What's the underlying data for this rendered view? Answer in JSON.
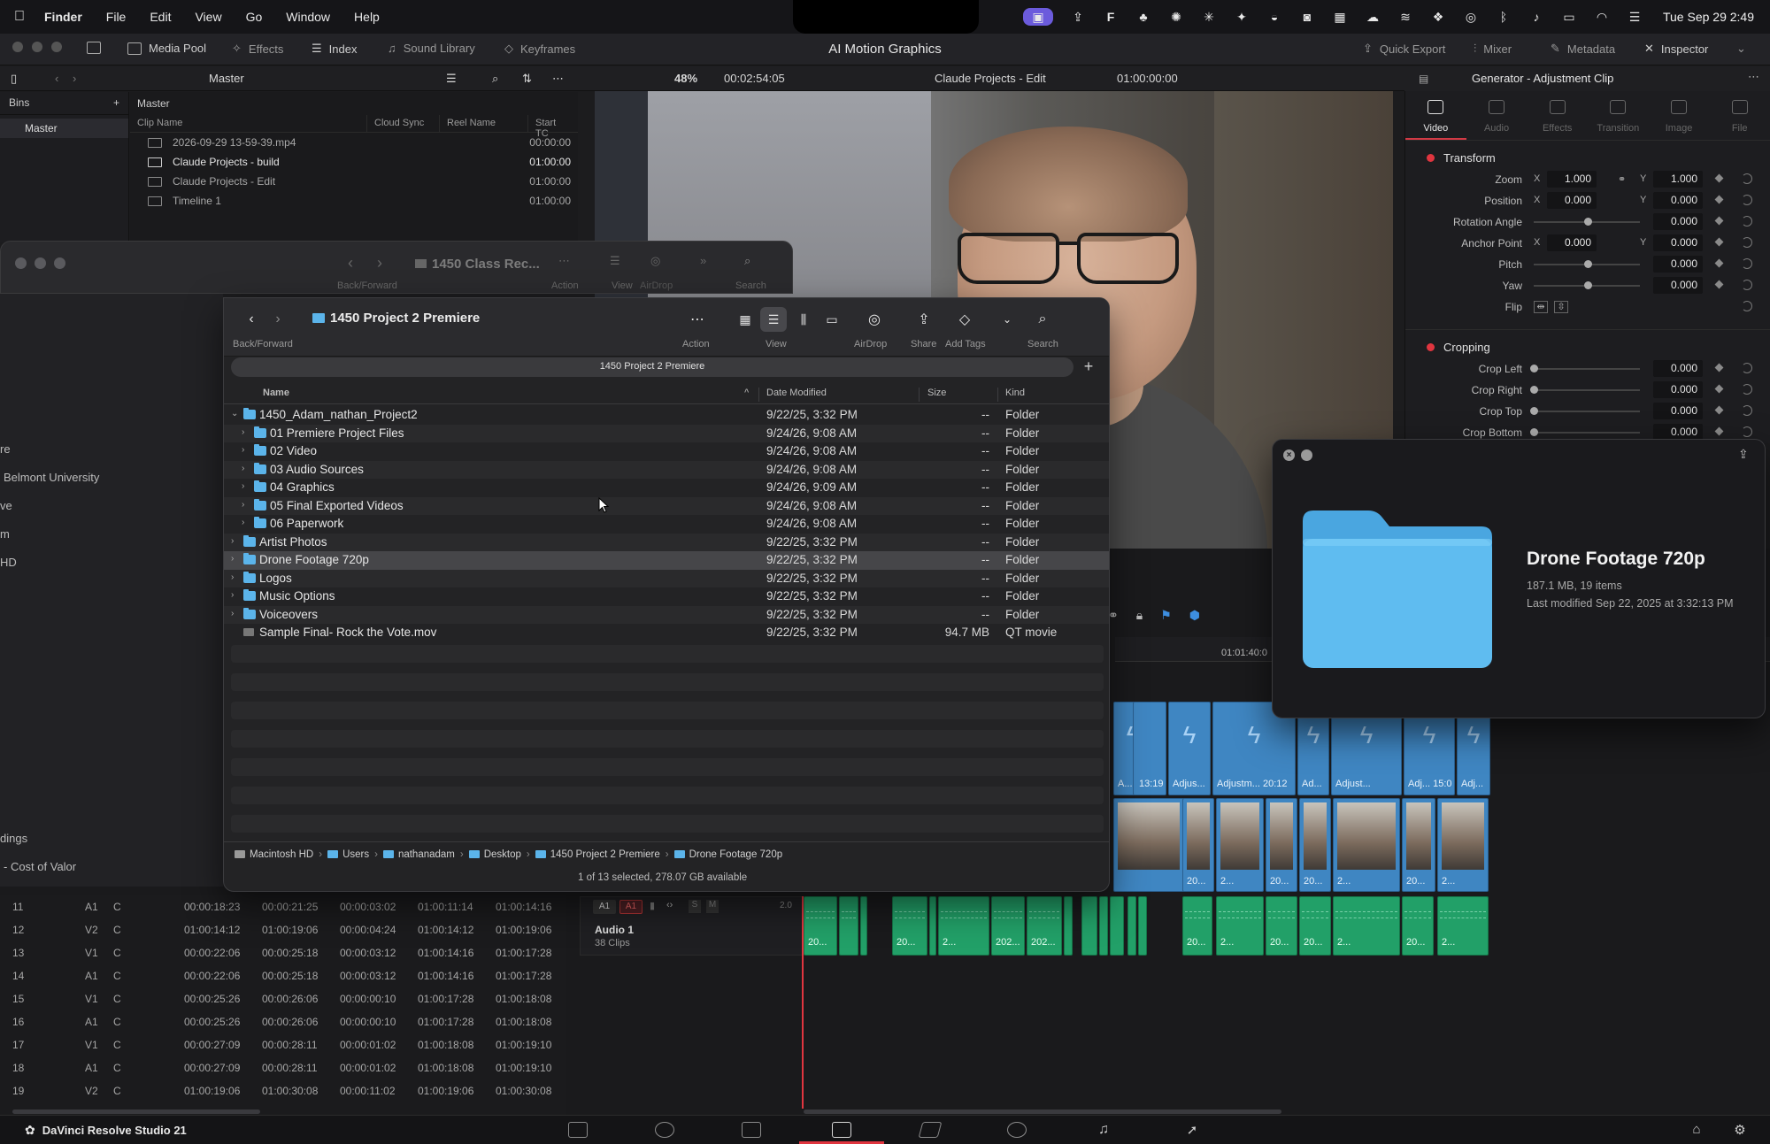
{
  "menubar": {
    "app": "Finder",
    "items": [
      "File",
      "Edit",
      "View",
      "Go",
      "Window",
      "Help"
    ],
    "clock": "Tue Sep 29  2:49"
  },
  "resolve": {
    "project_title": "AI Motion Graphics",
    "toolbar_left": {
      "media_pool": "Media Pool",
      "effects": "Effects",
      "index": "Index",
      "sound_library": "Sound Library",
      "keyframes": "Keyframes"
    },
    "toolbar_right": {
      "quick_export": "Quick Export",
      "mixer": "Mixer",
      "metadata": "Metadata",
      "inspector": "Inspector"
    },
    "bin_name": "Master",
    "zoom": "48%",
    "timecode": "00:02:54:05",
    "timeline_name": "Claude Projects - Edit",
    "timeline_tc": "01:00:00:00",
    "bins": {
      "header": "Bins",
      "master": "Master"
    },
    "pool": {
      "header": "Master",
      "columns": [
        "Clip Name",
        "Cloud Sync",
        "Reel Name",
        "Start TC"
      ],
      "rows": [
        {
          "name": "2026-09-29 13-59-39.mp4",
          "tc": "00:00:00"
        },
        {
          "name": "Claude Projects - build",
          "tc": "01:00:00"
        },
        {
          "name": "Claude Projects - Edit",
          "tc": "01:00:00"
        },
        {
          "name": "Timeline 1",
          "tc": "01:00:00"
        }
      ]
    },
    "inspector": {
      "title": "Generator - Adjustment Clip",
      "tabs": [
        "Video",
        "Audio",
        "Effects",
        "Transition",
        "Image",
        "File"
      ],
      "transform": {
        "label": "Transform",
        "zoom": {
          "label": "Zoom",
          "x": "1.000",
          "y": "1.000"
        },
        "position": {
          "label": "Position",
          "x": "0.000",
          "y": "0.000"
        },
        "rotation": {
          "label": "Rotation Angle",
          "value": "0.000"
        },
        "anchor": {
          "label": "Anchor Point",
          "x": "0.000",
          "y": "0.000"
        },
        "pitch": {
          "label": "Pitch",
          "value": "0.000"
        },
        "yaw": {
          "label": "Yaw",
          "value": "0.000"
        },
        "flip": {
          "label": "Flip"
        }
      },
      "cropping": {
        "label": "Cropping",
        "left": {
          "label": "Crop Left",
          "value": "0.000"
        },
        "right": {
          "label": "Crop Right",
          "value": "0.000"
        },
        "top": {
          "label": "Crop Top",
          "value": "0.000"
        },
        "bottom": {
          "label": "Crop Bottom",
          "value": "0.000"
        }
      },
      "axis_x": "X",
      "axis_y": "Y"
    },
    "timeline": {
      "ruler_tc": "01:01:40:0",
      "video_clips_top": [
        "A...",
        "13:19",
        "Adjus...",
        "Adjustm... 20:12",
        "Ad...",
        "Adjust...",
        "Adj... 15:07",
        "Adj..."
      ],
      "video_clips_bottom": [
        "20...",
        "2...",
        "20...",
        "20...",
        "2...",
        "20...",
        "2..."
      ],
      "audio_clips": [
        "20...",
        "20...",
        "2...",
        "202...",
        "202...",
        "20...",
        "2...",
        "20...",
        "20...",
        "2...",
        "20...",
        "2..."
      ],
      "audio_track": {
        "a1": "A1",
        "a1b": "A1",
        "s": "S",
        "m": "M",
        "vol": "2.0",
        "name": "Audio 1",
        "count": "38 Clips"
      }
    },
    "edit_index": [
      [
        "11",
        "A1",
        "C",
        "00:00:18:23",
        "00:00:21:25",
        "00:00:03:02",
        "01:00:11:14",
        "01:00:14:16"
      ],
      [
        "12",
        "V2",
        "C",
        "01:00:14:12",
        "01:00:19:06",
        "00:00:04:24",
        "01:00:14:12",
        "01:00:19:06"
      ],
      [
        "13",
        "V1",
        "C",
        "00:00:22:06",
        "00:00:25:18",
        "00:00:03:12",
        "01:00:14:16",
        "01:00:17:28"
      ],
      [
        "14",
        "A1",
        "C",
        "00:00:22:06",
        "00:00:25:18",
        "00:00:03:12",
        "01:00:14:16",
        "01:00:17:28"
      ],
      [
        "15",
        "V1",
        "C",
        "00:00:25:26",
        "00:00:26:06",
        "00:00:00:10",
        "01:00:17:28",
        "01:00:18:08"
      ],
      [
        "16",
        "A1",
        "C",
        "00:00:25:26",
        "00:00:26:06",
        "00:00:00:10",
        "01:00:17:28",
        "01:00:18:08"
      ],
      [
        "17",
        "V1",
        "C",
        "00:00:27:09",
        "00:00:28:11",
        "00:00:01:02",
        "01:00:18:08",
        "01:00:19:10"
      ],
      [
        "18",
        "A1",
        "C",
        "00:00:27:09",
        "00:00:28:11",
        "00:00:01:02",
        "01:00:18:08",
        "01:00:19:10"
      ],
      [
        "19",
        "V2",
        "C",
        "01:00:19:06",
        "01:00:30:08",
        "00:00:11:02",
        "01:00:19:06",
        "01:00:30:08"
      ]
    ],
    "app_name": "DaVinci Resolve Studio 21"
  },
  "finder_back": {
    "title": "1450 Class Rec...",
    "labels": {
      "back_forward": "Back/Forward",
      "action": "Action",
      "view": "View",
      "airdrop": "AirDrop",
      "search": "Search"
    },
    "sidebar_fragments": [
      "re",
      "Belmont University",
      "ve",
      "m",
      "HD",
      "dings",
      "- Cost of Valor"
    ]
  },
  "finder": {
    "title": "1450 Project 2 Premiere",
    "path_pill": "1450 Project 2 Premiere",
    "toolbar_labels": {
      "back_forward": "Back/Forward",
      "action": "Action",
      "view": "View",
      "airdrop": "AirDrop",
      "share": "Share",
      "add_tags": "Add Tags",
      "search": "Search"
    },
    "columns": {
      "name": "Name",
      "date": "Date Modified",
      "size": "Size",
      "kind": "Kind"
    },
    "rows": [
      {
        "name": "1450_Adam_nathan_Project2",
        "date": "9/22/25, 3:32 PM",
        "size": "--",
        "kind": "Folder",
        "level": 0,
        "open": true,
        "type": "folder"
      },
      {
        "name": "01 Premiere Project Files",
        "date": "9/24/26, 9:08 AM",
        "size": "--",
        "kind": "Folder",
        "level": 1,
        "type": "folder"
      },
      {
        "name": "02 Video",
        "date": "9/24/26, 9:08 AM",
        "size": "--",
        "kind": "Folder",
        "level": 1,
        "type": "folder"
      },
      {
        "name": "03 Audio Sources",
        "date": "9/24/26, 9:08 AM",
        "size": "--",
        "kind": "Folder",
        "level": 1,
        "type": "folder"
      },
      {
        "name": "04 Graphics",
        "date": "9/24/26, 9:09 AM",
        "size": "--",
        "kind": "Folder",
        "level": 1,
        "type": "folder"
      },
      {
        "name": "05 Final Exported Videos",
        "date": "9/24/26, 9:08 AM",
        "size": "--",
        "kind": "Folder",
        "level": 1,
        "type": "folder"
      },
      {
        "name": "06 Paperwork",
        "date": "9/24/26, 9:08 AM",
        "size": "--",
        "kind": "Folder",
        "level": 1,
        "type": "folder"
      },
      {
        "name": "Artist Photos",
        "date": "9/22/25, 3:32 PM",
        "size": "--",
        "kind": "Folder",
        "level": 0,
        "type": "folder"
      },
      {
        "name": "Drone Footage 720p",
        "date": "9/22/25, 3:32 PM",
        "size": "--",
        "kind": "Folder",
        "level": 0,
        "type": "folder",
        "selected": true
      },
      {
        "name": "Logos",
        "date": "9/22/25, 3:32 PM",
        "size": "--",
        "kind": "Folder",
        "level": 0,
        "type": "folder"
      },
      {
        "name": "Music Options",
        "date": "9/22/25, 3:32 PM",
        "size": "--",
        "kind": "Folder",
        "level": 0,
        "type": "folder"
      },
      {
        "name": "Voiceovers",
        "date": "9/22/25, 3:32 PM",
        "size": "--",
        "kind": "Folder",
        "level": 0,
        "type": "folder"
      },
      {
        "name": "Sample Final- Rock the Vote.mov",
        "date": "9/22/25, 3:32 PM",
        "size": "94.7 MB",
        "kind": "QT movie",
        "level": 0,
        "type": "movie"
      }
    ],
    "path_bar": [
      "Macintosh HD",
      "Users",
      "nathanadam",
      "Desktop",
      "1450 Project 2 Premiere",
      "Drone Footage 720p"
    ],
    "status": "1 of 13 selected, 278.07 GB available"
  },
  "quicklook": {
    "name": "Drone Footage 720p",
    "meta1": "187.1 MB, 19 items",
    "meta2": "Last modified Sep 22, 2025 at 3:32:13 PM"
  },
  "colors": {
    "folder_blue": "#5bb4ea",
    "clip_blue": "#3f86c2",
    "audio_green": "#22a068",
    "resolve_red": "#e0353f"
  }
}
